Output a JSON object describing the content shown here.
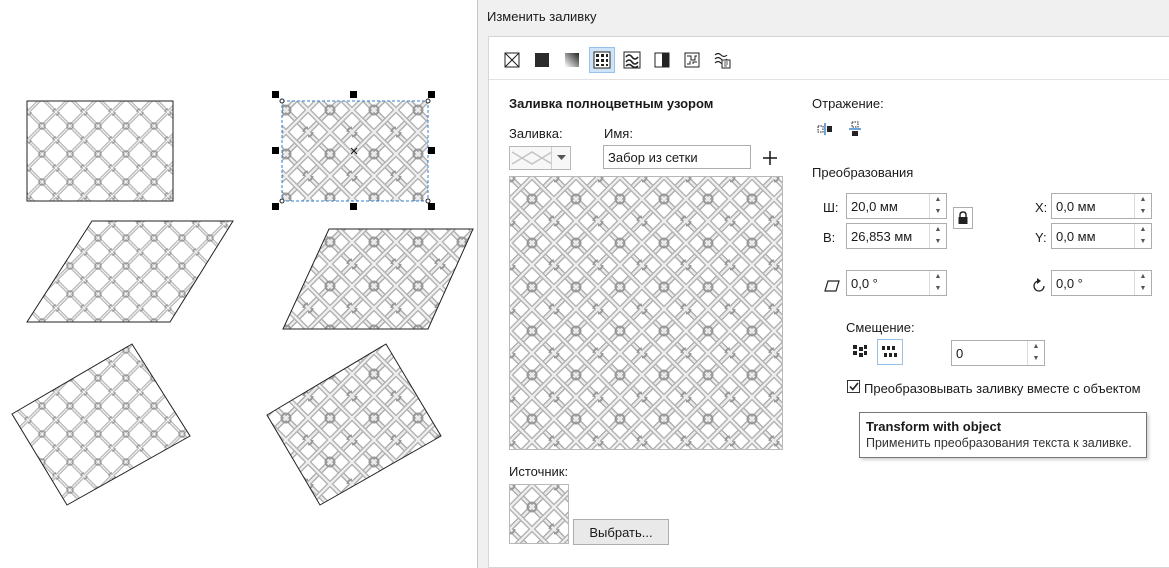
{
  "dialog": {
    "title": "Изменить заливку",
    "fill_types": [
      {
        "name": "no-fill",
        "icon": "no-fill-icon"
      },
      {
        "name": "uniform",
        "icon": "uniform-fill-icon"
      },
      {
        "name": "fountain",
        "icon": "fountain-fill-icon"
      },
      {
        "name": "vector-pattern",
        "icon": "vector-pattern-icon",
        "active": true
      },
      {
        "name": "bitmap-pattern",
        "icon": "bitmap-pattern-icon"
      },
      {
        "name": "two-color",
        "icon": "two-color-pattern-icon"
      },
      {
        "name": "texture",
        "icon": "texture-fill-icon"
      },
      {
        "name": "postscript",
        "icon": "postscript-fill-icon"
      }
    ],
    "section_title": "Заливка полноцветным узором",
    "fill_label": "Заливка:",
    "name_label": "Имя:",
    "name_value": "Забор из сетки",
    "source_label": "Источник:",
    "choose_button": "Выбрать...",
    "mirror_label": "Отражение:",
    "transform_label": "Преобразования",
    "width_label": "Ш:",
    "width_value": "20,0 мм",
    "height_label": "В:",
    "height_value": "26,853 мм",
    "x_label": "X:",
    "x_value": "0,0 мм",
    "y_label": "Y:",
    "y_value": "0,0 мм",
    "skew_value": "0,0 °",
    "rotate_value": "0,0 °",
    "offset_label": "Смещение:",
    "offset_value": "0",
    "transform_checkbox_label": "Преобразовывать заливку вместе с объектом",
    "transform_checkbox_checked": true
  },
  "tooltip": {
    "title": "Transform with object",
    "text": "Применить преобразования текста к заливке."
  },
  "colors": {
    "accent": "#0a67c2",
    "selection": "#2f7fd0",
    "active_tab": "#cfe4f7"
  }
}
